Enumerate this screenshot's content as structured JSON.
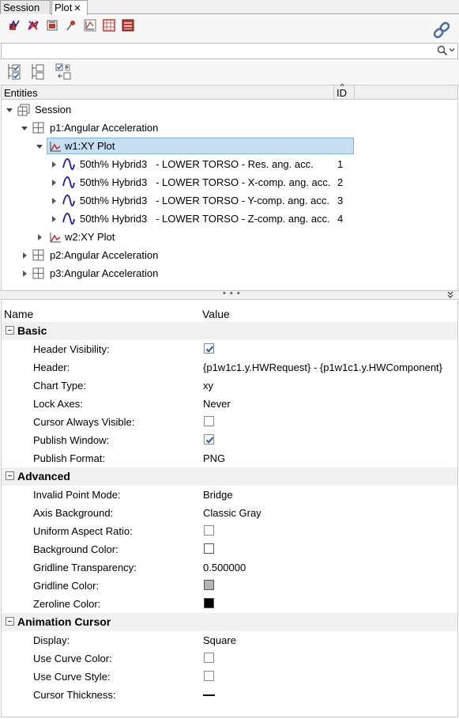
{
  "tabs": [
    {
      "label": "Session"
    },
    {
      "label": "Plot",
      "close": "✕"
    }
  ],
  "search": {
    "placeholder": "",
    "value": ""
  },
  "entities_header": {
    "name": "Entities",
    "id": "ID"
  },
  "tree": {
    "session": "Session",
    "p1": "p1:Angular Acceleration",
    "w1": "w1:XY Plot",
    "curves": [
      {
        "label": "50th% Hybrid3   - LOWER TORSO - Res. ang. acc.",
        "id": "1"
      },
      {
        "label": "50th% Hybrid3   - LOWER TORSO - X-comp. ang. acc.",
        "id": "2"
      },
      {
        "label": "50th% Hybrid3   - LOWER TORSO - Y-comp. ang. acc.",
        "id": "3"
      },
      {
        "label": "50th% Hybrid3   - LOWER TORSO - Z-comp. ang. acc.",
        "id": "4"
      }
    ],
    "w2": "w2:XY Plot",
    "p2": "p2:Angular Acceleration",
    "p3": "p3:Angular Acceleration"
  },
  "splitter_dots": "• • •",
  "props_header": {
    "name": "Name",
    "value": "Value"
  },
  "sections": {
    "basic": "Basic",
    "advanced": "Advanced",
    "animation": "Animation Cursor"
  },
  "basic": [
    {
      "name": "Header Visibility:",
      "checked": true
    },
    {
      "name": "Header:",
      "value": "{p1w1c1.y.HWRequest} - {p1w1c1.y.HWComponent}"
    },
    {
      "name": "Chart Type:",
      "value": "xy"
    },
    {
      "name": "Lock Axes:",
      "value": "Never"
    },
    {
      "name": "Cursor Always Visible:",
      "checked": false
    },
    {
      "name": "Publish Window:",
      "checked": true
    },
    {
      "name": "Publish Format:",
      "value": "PNG"
    }
  ],
  "advanced": [
    {
      "name": "Invalid Point Mode:",
      "value": "Bridge"
    },
    {
      "name": "Axis Background:",
      "value": "Classic Gray"
    },
    {
      "name": "Uniform Aspect Ratio:",
      "checked": false
    },
    {
      "name": "Background Color:",
      "color": "#ffffff"
    },
    {
      "name": "Gridline Transparency:",
      "value": "0.500000"
    },
    {
      "name": "Gridline Color:",
      "color": "#b4b4b4"
    },
    {
      "name": "Zeroline Color:",
      "color": "#000000"
    }
  ],
  "animation": [
    {
      "name": "Display:",
      "value": "Square"
    },
    {
      "name": "Use Curve Color:",
      "checked": false
    },
    {
      "name": "Use Curve Style:",
      "checked": false
    },
    {
      "name": "Cursor Thickness:",
      "line": true
    }
  ],
  "colors": {
    "selection": "#c6dff2",
    "curve": "#1a1aa8",
    "plot_icon": "#c0282e"
  },
  "icons": [
    "curve-add-icon",
    "curve-delete-icon",
    "page-icon",
    "pin-icon",
    "axis-icon",
    "grid-icon",
    "window-icon",
    "link-icon",
    "search-icon",
    "chevron-down-icon"
  ]
}
